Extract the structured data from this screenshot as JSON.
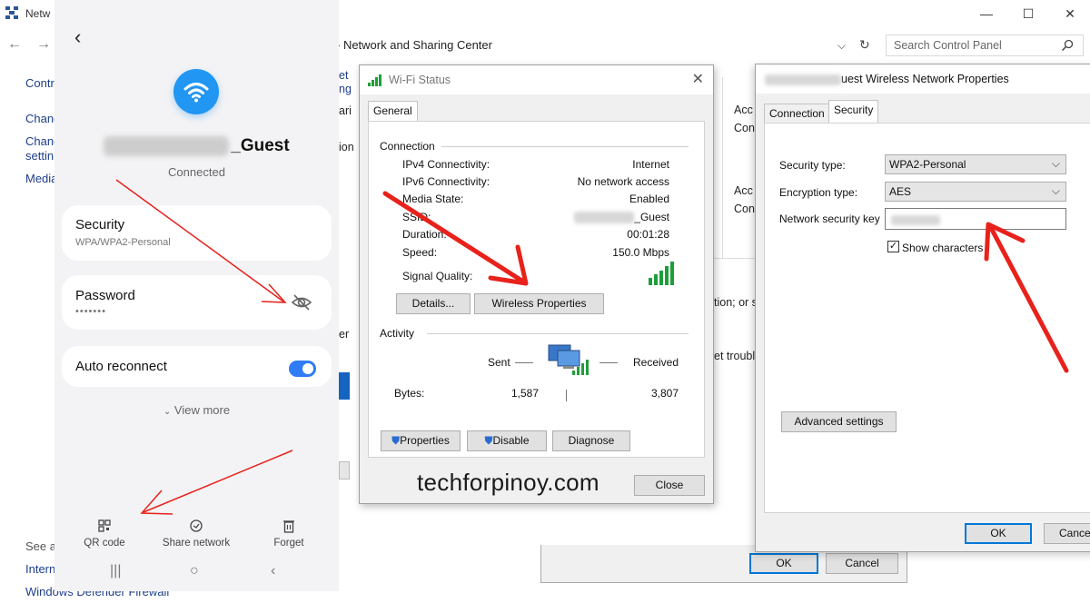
{
  "control_panel": {
    "title": "Netw",
    "breadcrumb": "› Network and Sharing Center",
    "search_placeholder": "Search Control Panel",
    "sidebar": [
      "Contr",
      "Chang",
      "Chang",
      "settin",
      "Media"
    ],
    "footer": [
      "See al",
      "Intern",
      "Windows Defender Firewall"
    ],
    "right_fragments": [
      "Acc",
      "Con",
      "Acc",
      "Con",
      "tion; or s",
      "et trouble"
    ],
    "left_fragments": [
      "et",
      "ng",
      "ari",
      "ion",
      "er"
    ],
    "behind_ok": "OK",
    "behind_cancel": "Cancel"
  },
  "phone": {
    "ssid_suffix": "_Guest",
    "status": "Connected",
    "security_title": "Security",
    "security_value": "WPA/WPA2-Personal",
    "password_title": "Password",
    "password_value": "•••••••",
    "auto_reconnect": "Auto reconnect",
    "auto_reconnect_on": true,
    "view_more": "View more",
    "actions": [
      {
        "label": "QR code",
        "icon": "qr-code-icon"
      },
      {
        "label": "Share network",
        "icon": "share-network-icon"
      },
      {
        "label": "Forget",
        "icon": "trash-icon"
      }
    ]
  },
  "wifi_status": {
    "title": "Wi-Fi Status",
    "tab": "General",
    "connection_label": "Connection",
    "rows": [
      {
        "label": "IPv4 Connectivity:",
        "value": "Internet"
      },
      {
        "label": "IPv6 Connectivity:",
        "value": "No network access"
      },
      {
        "label": "Media State:",
        "value": "Enabled"
      },
      {
        "label": "SSID:",
        "value": "_Guest"
      },
      {
        "label": "Duration:",
        "value": "00:01:28"
      },
      {
        "label": "Speed:",
        "value": "150.0 Mbps"
      }
    ],
    "signal_label": "Signal Quality:",
    "details_button": "Details...",
    "wireless_properties_button": "Wireless Properties",
    "activity_label": "Activity",
    "sent_label": "Sent",
    "received_label": "Received",
    "bytes_label": "Bytes:",
    "bytes_sent": "1,587",
    "bytes_received": "3,807",
    "properties_button": "Properties",
    "disable_button": "Disable",
    "diagnose_button": "Diagnose",
    "close_button": "Close",
    "watermark": "techforpinoy.com"
  },
  "wireless_props": {
    "title_suffix": "uest Wireless Network Properties",
    "tabs": [
      "Connection",
      "Security"
    ],
    "active_tab": "Security",
    "security_type_label": "Security type:",
    "security_type_value": "WPA2-Personal",
    "encryption_type_label": "Encryption type:",
    "encryption_type_value": "AES",
    "network_key_label": "Network security key",
    "show_characters_label": "Show characters",
    "show_characters_checked": true,
    "advanced_button": "Advanced settings",
    "ok_button": "OK",
    "cancel_button": "Cance"
  },
  "colors": {
    "accent_blue": "#2196f3",
    "toggle_blue": "#2f7cf6",
    "arrow_red": "#e8221b",
    "signal_green": "#1e9e3a",
    "dialog_bg": "#f0f0f0"
  }
}
